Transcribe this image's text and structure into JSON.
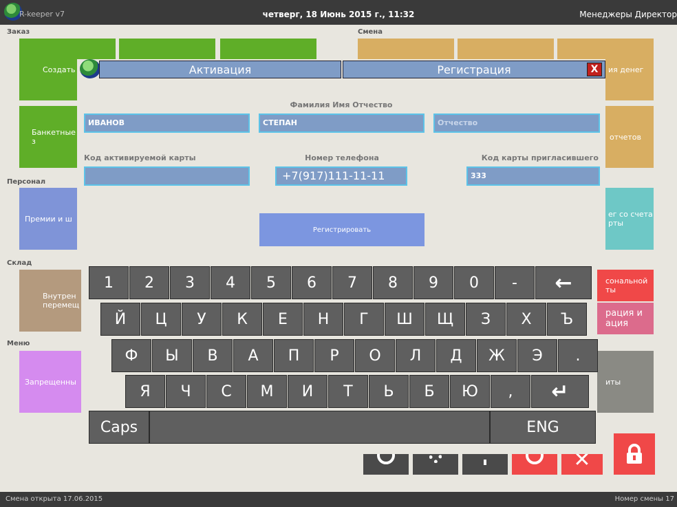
{
  "topbar": {
    "brand": "R-keeper v7",
    "datetime": "четверг, 18 Июнь 2015 г., 11:32",
    "managers": "Менеджеры Директор"
  },
  "sections": {
    "order": "Заказ",
    "shift": "Смена",
    "staff": "Персонал",
    "warehouse": "Склад",
    "menu": "Меню"
  },
  "tiles": {
    "create": "Создать з",
    "banquet": "Банкетные з",
    "bonus": "Премии и ш",
    "internal1": "Внутрен",
    "internal2": "перемещ",
    "forbidden": "Запрещенны",
    "money": "ия денег",
    "reports": "отчетов",
    "transfer1": "ег со счета",
    "transfer2": "рты",
    "personal1": "сональной",
    "personal2": "ты",
    "reg1": "рация и",
    "reg2": "ация",
    "other": "иты"
  },
  "colors": {
    "green": "#5fae28",
    "tan": "#d8ae62",
    "blue_tile": "#7f94d8",
    "teal": "#6ec8c6",
    "red": "#f04848",
    "pink": "#dc6b8c",
    "purple": "#d58bef",
    "brown": "#b49a7e",
    "gray": "#8a8a84"
  },
  "modal": {
    "tab_activation": "Активация",
    "tab_registration": "Регистрация",
    "close_glyph": "X",
    "fio_label": "Фамилия Имя Отчество",
    "last_name": "ИВАНОВ",
    "first_name": "СТЕПАН",
    "patronymic_placeholder": "Отчество",
    "card_code_label": "Код активируемой карты",
    "card_code": "",
    "phone_label": "Номер телефона",
    "phone": "+7(917)111-11-11",
    "inviter_label": "Код карты пригласившего",
    "inviter_code": "333",
    "register_button": "Регистрировать"
  },
  "keyboard": {
    "row1": [
      "1",
      "2",
      "3",
      "4",
      "5",
      "6",
      "7",
      "8",
      "9",
      "0",
      "-",
      "←"
    ],
    "row2": [
      "Й",
      "Ц",
      "У",
      "К",
      "Е",
      "Н",
      "Г",
      "Ш",
      "Щ",
      "З",
      "Х",
      "Ъ"
    ],
    "row3": [
      "Ф",
      "Ы",
      "В",
      "А",
      "П",
      "Р",
      "О",
      "Л",
      "Д",
      "Ж",
      "Э",
      "."
    ],
    "row4": [
      "Я",
      "Ч",
      "С",
      "М",
      "И",
      "Т",
      "Ь",
      "Б",
      "Ю",
      ",",
      "↵"
    ],
    "caps": "Caps",
    "lang": "ENG"
  },
  "status": {
    "left": "Смена открыта 17.06.2015",
    "right": "Номер смены 17"
  }
}
